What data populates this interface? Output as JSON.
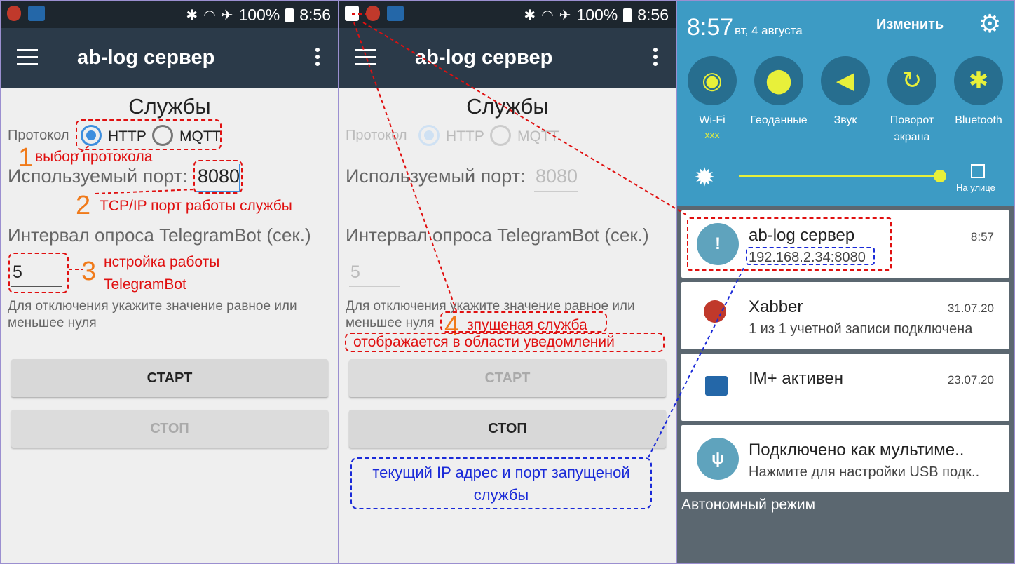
{
  "status": {
    "battery": "100%",
    "time1": "8:56",
    "time2": "8:56"
  },
  "app": {
    "title": "ab-log сервер"
  },
  "screen": {
    "heading": "Службы",
    "protocol_label": "Протокол",
    "http": "HTTP",
    "mqtt": "MQTT",
    "port_label": "Используемый порт:",
    "port_value": "8080",
    "interval_label": "Интервал опроса TelegramBot (сек.)",
    "interval_value": "5",
    "hint_line1": "Для отключения укажите значение равное или",
    "hint_line2": "меньшее нуля",
    "start": "СТАРТ",
    "stop": "СТОП"
  },
  "annotations": {
    "n1": "1",
    "t1": "выбор протокола",
    "n2": "2",
    "t2": "TCP/IP порт работы службы",
    "n3": "3",
    "t3a": "нстройка работы",
    "t3b": "TelegramBot",
    "n4": "4",
    "t4a": "зпущеная служба",
    "t4b": "отображается в области уведомлений",
    "blue_a": "текущий IP адрес и порт запущеной",
    "blue_b": "службы"
  },
  "shade": {
    "time": "8:57",
    "date": "вт, 4 августа",
    "edit": "Изменить",
    "tiles": [
      {
        "label": "Wi-Fi",
        "sub": "xxx",
        "icon": "wifi-icon"
      },
      {
        "label": "Геоданные",
        "sub": "",
        "icon": "location-icon"
      },
      {
        "label": "Звук",
        "sub": "",
        "icon": "sound-icon"
      },
      {
        "label": "Поворот",
        "label2": "экрана",
        "icon": "rotate-icon"
      },
      {
        "label": "Bluetooth",
        "sub": "",
        "icon": "bluetooth-icon"
      }
    ],
    "outdoor": "На улице",
    "notifications": [
      {
        "title": "ab-log сервер",
        "time": "8:57",
        "sub": "192.168.2.34:8080"
      },
      {
        "title": "Xabber",
        "time": "31.07.20",
        "sub": "1 из 1 учетной записи подключена"
      },
      {
        "title": "IM+ активен",
        "time": "23.07.20",
        "sub": ""
      },
      {
        "title": "Подключено как мультиме..",
        "time": "",
        "sub": "Нажмите для настройки USB подк.."
      }
    ],
    "offline": "Автономный режим"
  },
  "colors": {
    "toolbar": "#2b3a49",
    "statusbar": "#1d262e",
    "shade": "#3d9bc4",
    "accent_yellow": "#e8f03a",
    "radio_blue": "#3d8ede",
    "annotation_red": "#e01010",
    "annotation_blue": "#1a2ad8",
    "annotation_orange": "#f07a1a"
  }
}
